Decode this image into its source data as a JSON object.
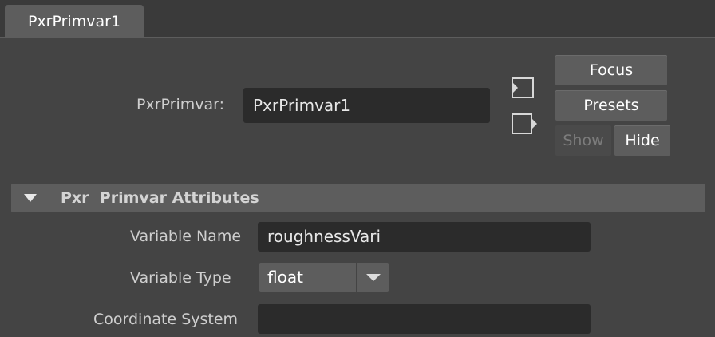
{
  "tab": {
    "label": "PxrPrimvar1"
  },
  "node": {
    "label": "PxrPrimvar:",
    "value": "PxrPrimvar1"
  },
  "buttons": {
    "focus": "Focus",
    "presets": "Presets",
    "show": "Show",
    "hide": "Hide"
  },
  "icons": {
    "input_connection": "input-connection-icon",
    "output_connection": "output-connection-icon",
    "collapse_arrow": "triangle-down-icon",
    "dropdown_arrow": "chevron-down-icon"
  },
  "section": {
    "title": "Pxr  Primvar Attributes",
    "collapsed": false
  },
  "attributes": {
    "variable_name": {
      "label": "Variable Name",
      "value": "roughnessVari"
    },
    "variable_type": {
      "label": "Variable Type",
      "value": "float"
    },
    "coordinate_system": {
      "label": "Coordinate System",
      "value": ""
    }
  },
  "colors": {
    "background": "#444444",
    "tab_active": "#5d5d5d",
    "field": "#2b2b2b",
    "button": "#5d5d5d"
  }
}
